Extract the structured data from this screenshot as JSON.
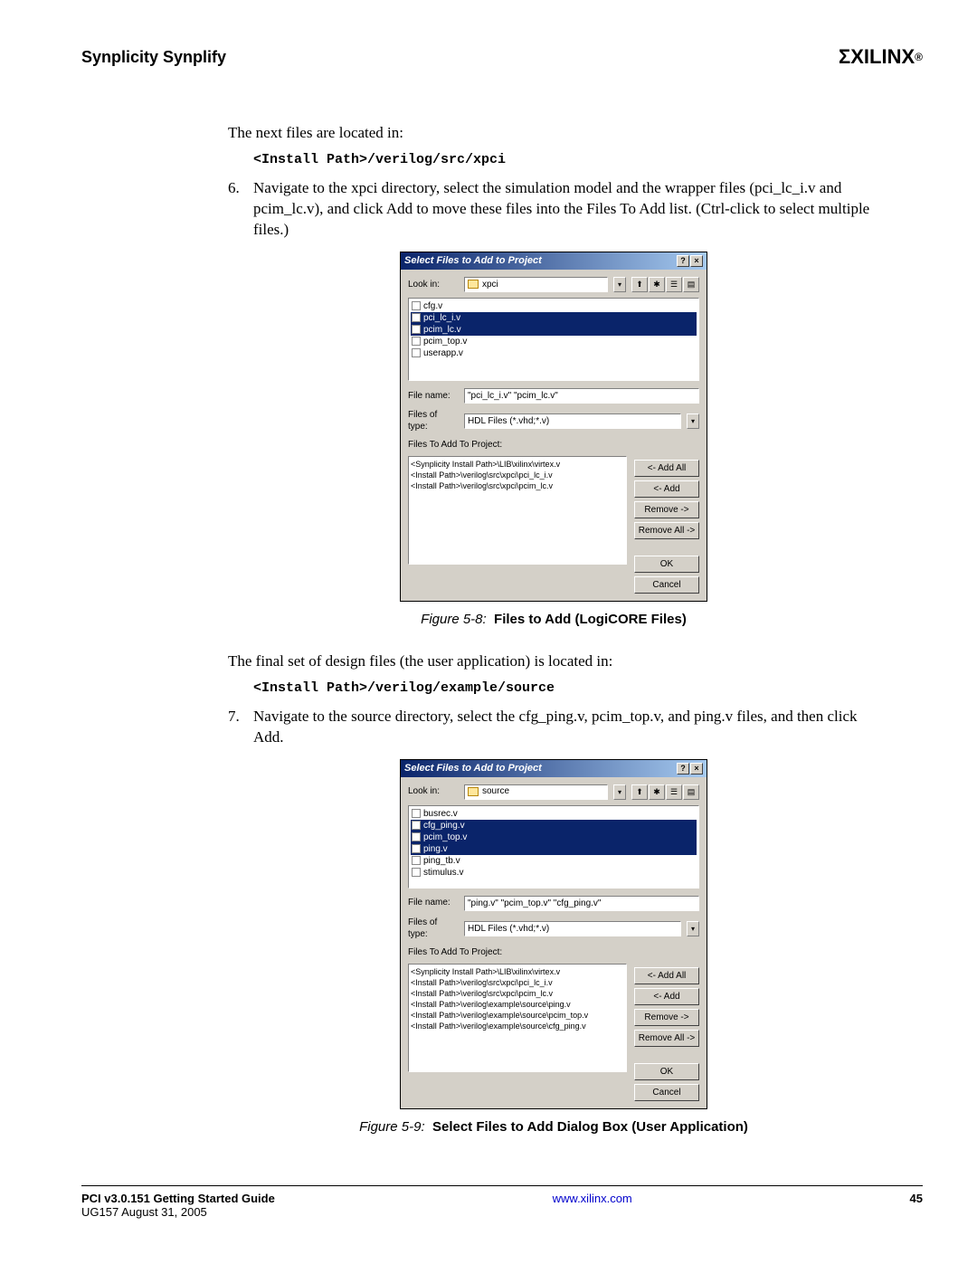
{
  "header": {
    "title": "Synplicity Synplify",
    "logo": "XILINX",
    "logo_r": "®"
  },
  "intro_text": "The next files are located in:",
  "code1": "<Install Path>/verilog/src/xpci",
  "step6": {
    "num": "6.",
    "text": "Navigate to the xpci directory, select the simulation model and the wrapper files (pci_lc_i.v and pcim_lc.v), and click Add to move these files into the Files To Add list. (Ctrl-click to select multiple files.)"
  },
  "dialog1": {
    "title": "Select Files to Add to Project",
    "lookin_label": "Look in:",
    "lookin_value": "xpci",
    "files": [
      {
        "name": "cfg.v",
        "selected": false
      },
      {
        "name": "pci_lc_i.v",
        "selected": true
      },
      {
        "name": "pcim_lc.v",
        "selected": true
      },
      {
        "name": "pcim_top.v",
        "selected": false
      },
      {
        "name": "userapp.v",
        "selected": false
      }
    ],
    "filename_label": "File name:",
    "filename_value": "\"pci_lc_i.v\" \"pcim_lc.v\"",
    "filetype_label": "Files of type:",
    "filetype_value": "HDL Files (*.vhd;*.v)",
    "addlist_label": "Files To Add To Project:",
    "addlist": [
      "<Synplicity Install Path>\\LIB\\xilinx\\virtex.v",
      "<Install Path>\\verilog\\src\\xpci\\pci_lc_i.v",
      "<Install Path>\\verilog\\src\\xpci\\pcim_lc.v"
    ],
    "buttons": {
      "addall": "<- Add All",
      "add": "<- Add",
      "remove": "Remove ->",
      "removeall": "Remove All ->",
      "ok": "OK",
      "cancel": "Cancel"
    }
  },
  "caption1": {
    "label": "Figure 5-8:",
    "title": "Files to Add (LogiCORE Files)"
  },
  "mid_text": "The final set of design files (the user application) is located in:",
  "code2": "<Install Path>/verilog/example/source",
  "step7": {
    "num": "7.",
    "text": "Navigate to the source directory, select the cfg_ping.v, pcim_top.v, and ping.v files, and then click Add."
  },
  "dialog2": {
    "title": "Select Files to Add to Project",
    "lookin_label": "Look in:",
    "lookin_value": "source",
    "files": [
      {
        "name": "busrec.v",
        "selected": false
      },
      {
        "name": "cfg_ping.v",
        "selected": true
      },
      {
        "name": "pcim_top.v",
        "selected": true
      },
      {
        "name": "ping.v",
        "selected": true
      },
      {
        "name": "ping_tb.v",
        "selected": false
      },
      {
        "name": "stimulus.v",
        "selected": false
      }
    ],
    "filename_label": "File name:",
    "filename_value": "\"ping.v\" \"pcim_top.v\" \"cfg_ping.v\"",
    "filetype_label": "Files of type:",
    "filetype_value": "HDL Files (*.vhd;*.v)",
    "addlist_label": "Files To Add To Project:",
    "addlist": [
      "<Synplicity Install Path>\\LIB\\xilinx\\virtex.v",
      "<Install Path>\\verilog\\src\\xpci\\pci_lc_i.v",
      "<Install Path>\\verilog\\src\\xpci\\pcim_lc.v",
      "<Install Path>\\verilog\\example\\source\\ping.v",
      "<Install Path>\\verilog\\example\\source\\pcim_top.v",
      "<Install Path>\\verilog\\example\\source\\cfg_ping.v"
    ],
    "buttons": {
      "addall": "<- Add All",
      "add": "<- Add",
      "remove": "Remove ->",
      "removeall": "Remove All ->",
      "ok": "OK",
      "cancel": "Cancel"
    }
  },
  "caption2": {
    "label": "Figure 5-9:",
    "title": "Select Files to Add Dialog Box (User Application)"
  },
  "footer": {
    "doc_title": "PCI v3.0.151 Getting Started Guide",
    "doc_sub": "UG157 August 31, 2005",
    "url": "www.xilinx.com",
    "page": "45"
  },
  "tb": {
    "help": "?",
    "close": "×",
    "drop": "▾",
    "up": "⬆",
    "new": "✱",
    "list": "☰",
    "det": "▤"
  }
}
